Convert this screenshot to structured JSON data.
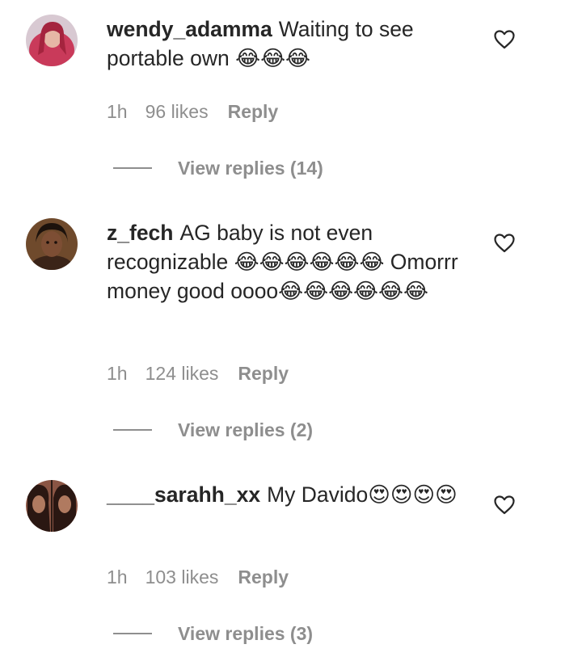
{
  "comments": [
    {
      "username": "wendy_adamma",
      "text": "Waiting to see portable own 😂😂😂",
      "time": "1h",
      "likes": "96 likes",
      "reply_label": "Reply",
      "view_replies": "View replies (14)",
      "avatar_colors": [
        "#c93a5a",
        "#3a1a22"
      ]
    },
    {
      "username": "z_fech",
      "text": "AG baby is not even recognizable 😂😂😂😂😂😂 Omorrr money good oooo😂😂😂😂😂😂",
      "time": "1h",
      "likes": "124 likes",
      "reply_label": "Reply",
      "view_replies": "View replies (2)",
      "avatar_colors": [
        "#7a5030",
        "#2a1a12"
      ]
    },
    {
      "username": "____sarahh_xx",
      "text": "My Davido😍😍😍😍",
      "time": "1h",
      "likes": "103 likes",
      "reply_label": "Reply",
      "view_replies": "View replies (3)",
      "avatar_colors": [
        "#a05a48",
        "#24140f"
      ]
    }
  ],
  "icons": {
    "like": "heart-outline-icon"
  }
}
